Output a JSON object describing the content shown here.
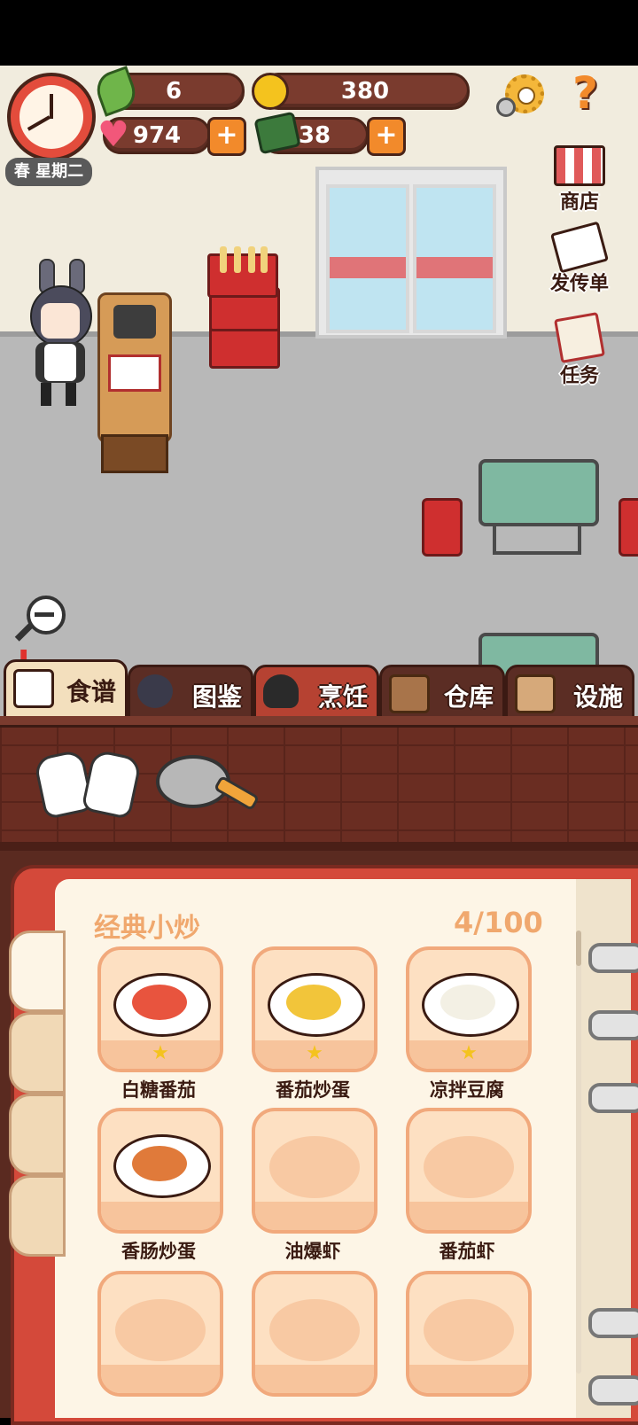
{
  "hud": {
    "leaf_count": "6",
    "coins": "380",
    "hearts": "974",
    "books": "38",
    "season_day": "春 星期二",
    "plus": "+"
  },
  "side_menu": {
    "shop": "商店",
    "flyer": "发传单",
    "tasks": "任务"
  },
  "help_label": "?",
  "alert_mark": "!",
  "tabs": [
    {
      "label": "食谱",
      "state": "selected"
    },
    {
      "label": "图鉴",
      "state": "normal"
    },
    {
      "label": "烹饪",
      "state": "active"
    },
    {
      "label": "仓库",
      "state": "normal"
    },
    {
      "label": "设施",
      "state": "normal"
    }
  ],
  "recipe_book": {
    "category_title": "经典小炒",
    "progress": "4/100",
    "recipes": [
      {
        "name": "白糖番茄",
        "unlocked": true,
        "stars": 1
      },
      {
        "name": "番茄炒蛋",
        "unlocked": true,
        "stars": 1
      },
      {
        "name": "凉拌豆腐",
        "unlocked": true,
        "stars": 1
      },
      {
        "name": "香肠炒蛋",
        "unlocked": true,
        "stars": 0
      },
      {
        "name": "油爆虾",
        "unlocked": false,
        "stars": 0
      },
      {
        "name": "番茄虾",
        "unlocked": false,
        "stars": 0
      },
      {
        "name": "",
        "unlocked": false,
        "stars": 0
      },
      {
        "name": "",
        "unlocked": false,
        "stars": 0
      },
      {
        "name": "",
        "unlocked": false,
        "stars": 0
      }
    ]
  },
  "colors": {
    "accent_orange": "#f28a2b",
    "hud_brown": "#7a3b2e",
    "book_red": "#d4493a",
    "title_peach": "#f0a86e"
  },
  "icons": [
    "leaf-icon",
    "coin-icon",
    "heart-icon",
    "book-icon",
    "gear-icon",
    "help-icon",
    "clock-icon",
    "shop-icon",
    "flyer-icon",
    "task-icon",
    "zoom-out-icon",
    "gloves-icon",
    "frying-pan-icon"
  ]
}
